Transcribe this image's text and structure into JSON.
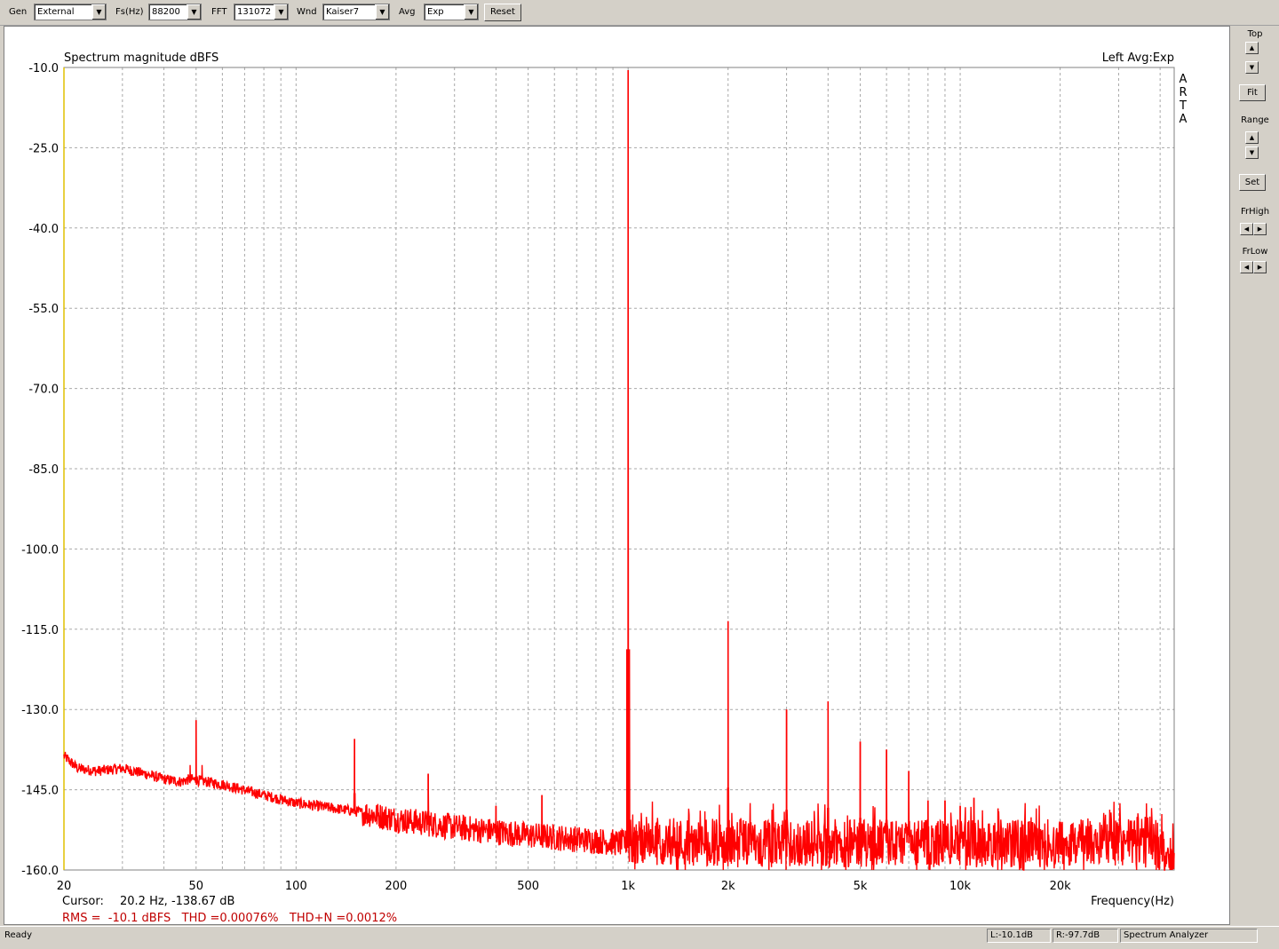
{
  "toolbar": {
    "gen_label": "Gen",
    "gen_value": "External",
    "fs_label": "Fs(Hz)",
    "fs_value": "88200",
    "fft_label": "FFT",
    "fft_value": "131072",
    "wnd_label": "Wnd",
    "wnd_value": "Kaiser7",
    "avg_label": "Avg",
    "avg_value": "Exp",
    "reset_label": "Reset"
  },
  "right_panel": {
    "top_label": "Top",
    "fit_label": "Fit",
    "range_label": "Range",
    "set_label": "Set",
    "frhigh_label": "FrHigh",
    "frlow_label": "FrLow"
  },
  "plot": {
    "brand_letters": [
      "A",
      "R",
      "T",
      "A"
    ],
    "cursor_label": "Cursor:",
    "cursor_value": "20.2 Hz, -138.67 dB",
    "stats_line": "RMS =  -10.1 dBFS   THD =0.00076%   THD+N =0.0012%"
  },
  "status": {
    "ready": "Ready",
    "left_level": "L:-10.1dB",
    "right_level": "R:-97.7dB",
    "mode": "Spectrum Analyzer"
  },
  "colors": {
    "trace": "#ff0000",
    "grid": "#a8a8a8",
    "stats": "#c00000",
    "yaxis_line": "#e0c000"
  },
  "chart_data": {
    "type": "line",
    "title": "Spectrum magnitude dBFS",
    "subtitle": "Left  Avg:Exp",
    "xlabel": "Frequency(Hz)",
    "ylabel": "",
    "x_scale": "log",
    "xlim": [
      20,
      44100
    ],
    "ylim": [
      -160,
      -10
    ],
    "grid": true,
    "x_ticks": [
      {
        "v": 20,
        "label": "20"
      },
      {
        "v": 50,
        "label": "50"
      },
      {
        "v": 100,
        "label": "100"
      },
      {
        "v": 200,
        "label": "200"
      },
      {
        "v": 500,
        "label": "500"
      },
      {
        "v": 1000,
        "label": "1k"
      },
      {
        "v": 2000,
        "label": "2k"
      },
      {
        "v": 5000,
        "label": "5k"
      },
      {
        "v": 10000,
        "label": "10k"
      },
      {
        "v": 20000,
        "label": "20k"
      }
    ],
    "y_ticks": [
      -10,
      -25,
      -40,
      -55,
      -70,
      -85,
      -100,
      -115,
      -130,
      -145,
      -160
    ],
    "y_tick_labels": [
      "-10.0",
      "-25.0",
      "-40.0",
      "-55.0",
      "-70.0",
      "-85.0",
      "-100.0",
      "-115.0",
      "-130.0",
      "-145.0",
      "-160.0"
    ],
    "series": [
      {
        "name": "",
        "color": "#ff0000",
        "floor": [
          [
            20,
            -138.7
          ],
          [
            22,
            -141
          ],
          [
            25,
            -141.5
          ],
          [
            30,
            -141
          ],
          [
            35,
            -142
          ],
          [
            40,
            -143
          ],
          [
            45,
            -143.5
          ],
          [
            48,
            -143
          ],
          [
            60,
            -144
          ],
          [
            80,
            -146
          ],
          [
            100,
            -147.5
          ],
          [
            150,
            -149
          ],
          [
            200,
            -150.5
          ],
          [
            300,
            -152
          ],
          [
            500,
            -153.5
          ],
          [
            800,
            -154.5
          ],
          [
            950,
            -155
          ],
          [
            1100,
            -154.5
          ],
          [
            2000,
            -155
          ],
          [
            5000,
            -155
          ],
          [
            10000,
            -155
          ],
          [
            20000,
            -155
          ],
          [
            38000,
            -154.5
          ],
          [
            44100,
            -159
          ]
        ],
        "peaks": [
          {
            "f": 50,
            "db": -132
          },
          {
            "f": 150,
            "db": -135.5
          },
          {
            "f": 250,
            "db": -142
          },
          {
            "f": 400,
            "db": -148
          },
          {
            "f": 550,
            "db": -146
          },
          {
            "f": 1000,
            "db": -10.5
          },
          {
            "f": 2000,
            "db": -113.5
          },
          {
            "f": 3000,
            "db": -130
          },
          {
            "f": 4000,
            "db": -128.5
          },
          {
            "f": 5000,
            "db": -136
          },
          {
            "f": 6000,
            "db": -137.5
          },
          {
            "f": 7000,
            "db": -141.5
          },
          {
            "f": 8000,
            "db": -147
          },
          {
            "f": 9000,
            "db": -147
          },
          {
            "f": 10000,
            "db": -148
          },
          {
            "f": 11000,
            "db": -146.5
          },
          {
            "f": 13000,
            "db": -148.5
          }
        ]
      }
    ]
  }
}
